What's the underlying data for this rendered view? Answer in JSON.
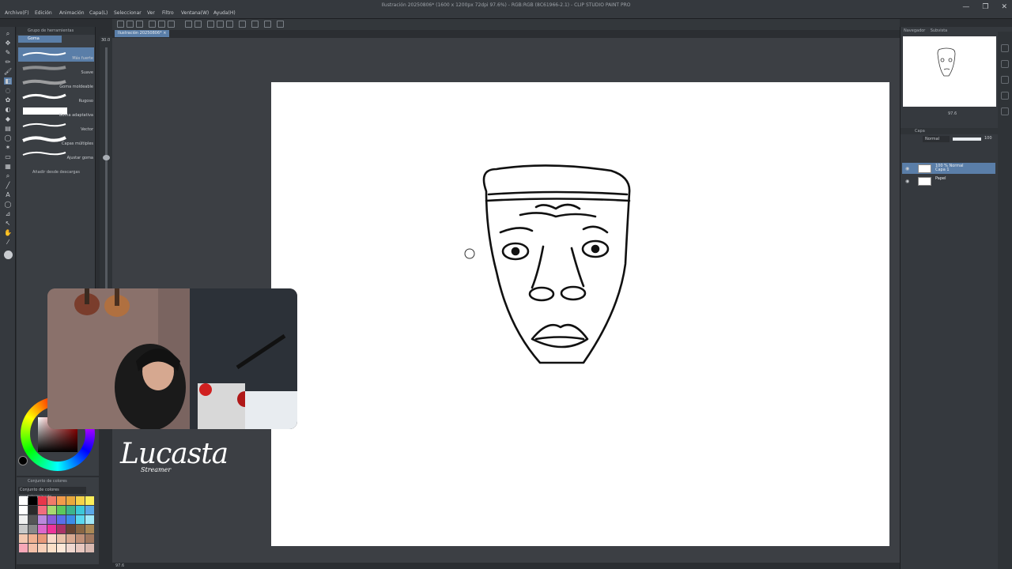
{
  "app": {
    "window_title": "Ilustración 20250806* (1600 x 1200px 72dpi 97.6%) - RGB:RGB (8C61966-2.1) - CLIP STUDIO PAINT PRO",
    "document_tab": "Ilustración 20250806* ×"
  },
  "menu": [
    "Archivo(F)",
    "Edición",
    "Animación",
    "Capa(L)",
    "Seleccionar",
    "Ver",
    "Filtro",
    "Ventana(W)",
    "Ayuda(H)"
  ],
  "subtool": {
    "panel_title": "Grupo de herramientas",
    "group": "Goma",
    "brushes": [
      "Más fuerte",
      "Suave",
      "Goma moldeable",
      "Rugoso",
      "Goma adaptativa",
      "Vector",
      "Capas múltiples",
      "Ajustar goma"
    ],
    "add_download": "Añadir desde descargas",
    "size_value": "30.0"
  },
  "palette": {
    "title": "Conjunto de colores",
    "set_name": "Conjunto de colores predeterminado",
    "colors": [
      "#ffffff",
      "#000000",
      "#e8364a",
      "#f07a6a",
      "#f29b4b",
      "#e8a83d",
      "#f5d24a",
      "#fbee5a",
      "#ffffff",
      "#2a2a2a",
      "#f26d7d",
      "#a8d86f",
      "#5cc85c",
      "#3cb48c",
      "#3cc8d8",
      "#5aa8e8",
      "#f0f0f0",
      "#555555",
      "#bb88dd",
      "#8a5cd8",
      "#5a6ee8",
      "#3c8ce8",
      "#5ad8f0",
      "#a0e8f8",
      "#c8c8c8",
      "#888888",
      "#dd66cc",
      "#ee3399",
      "#aa3366",
      "#664433",
      "#886644",
      "#aa8855",
      "#f4c8b0",
      "#f0b090",
      "#e89878",
      "#f8d8c8",
      "#e8c0a8",
      "#d8a890",
      "#c09078",
      "#a07860",
      "#f8a8b8",
      "#f4c0a8",
      "#f8d0b8",
      "#fce0c8",
      "#fde8d8",
      "#f0d8d0",
      "#e8c8c0",
      "#d8b8b0"
    ]
  },
  "status": {
    "zoom": "97.6"
  },
  "navigator": {
    "tab_label": "Navegador",
    "tab_label_2": "Subvista",
    "zoom": "97.6"
  },
  "layers": {
    "panel_title": "Capa",
    "blend_mode": "Normal",
    "opacity": "100",
    "items": [
      {
        "name": "100 % Normal\nCapa 1",
        "active": true
      },
      {
        "name": "Papel",
        "active": false
      }
    ]
  },
  "stream": {
    "logo_text": "Lucasta",
    "logo_sub": "Streamer"
  }
}
